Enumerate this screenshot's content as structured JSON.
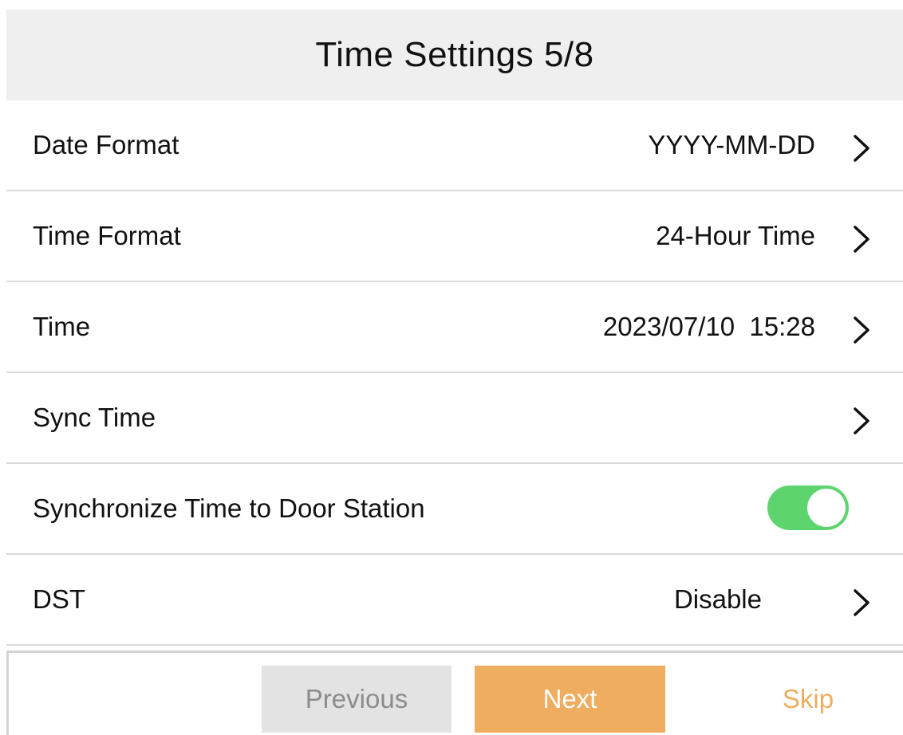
{
  "header": {
    "title": "Time Settings 5/8"
  },
  "settings": [
    {
      "label": "Date Format",
      "value": "YYYY-MM-DD",
      "control": "chevron-right-icon"
    },
    {
      "label": "Time Format",
      "value": "24-Hour Time",
      "control": "chevron-right-icon"
    },
    {
      "label": "Time",
      "value": "2023/07/10  15:28",
      "control": "chevron-right-icon"
    },
    {
      "label": "Sync Time",
      "value": "",
      "control": "chevron-right-icon"
    },
    {
      "label": "Synchronize Time to Door Station",
      "toggle_on": true,
      "control": "toggle"
    },
    {
      "label": "DST",
      "value": "Disable",
      "control": "chevron-right-icon"
    }
  ],
  "footer": {
    "previous_label": "Previous",
    "next_label": "Next",
    "skip_label": "Skip"
  },
  "colors": {
    "accent": "#eead5f",
    "toggle_on": "#5ed46f",
    "header_bg": "#efefef",
    "disabled_button_bg": "#e3e3e3"
  }
}
